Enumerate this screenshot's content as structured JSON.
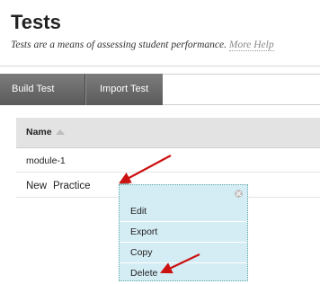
{
  "header": {
    "title": "Tests",
    "subtitle": "Tests are a means of assessing student performance.",
    "help_link": "More Help"
  },
  "toolbar": {
    "build_test": "Build Test",
    "import_test": "Import Test"
  },
  "table": {
    "column_header": "Name",
    "rows": [
      {
        "name": "module-1"
      },
      {
        "name_part1": "New",
        "name_part2": "Practice"
      }
    ]
  },
  "context_menu": {
    "items": [
      "Edit",
      "Export",
      "Copy",
      "Delete"
    ]
  },
  "colors": {
    "toolbar_bg": "#666666",
    "menu_bg": "#d4ecf4",
    "annotation_arrow": "#cc1111"
  }
}
